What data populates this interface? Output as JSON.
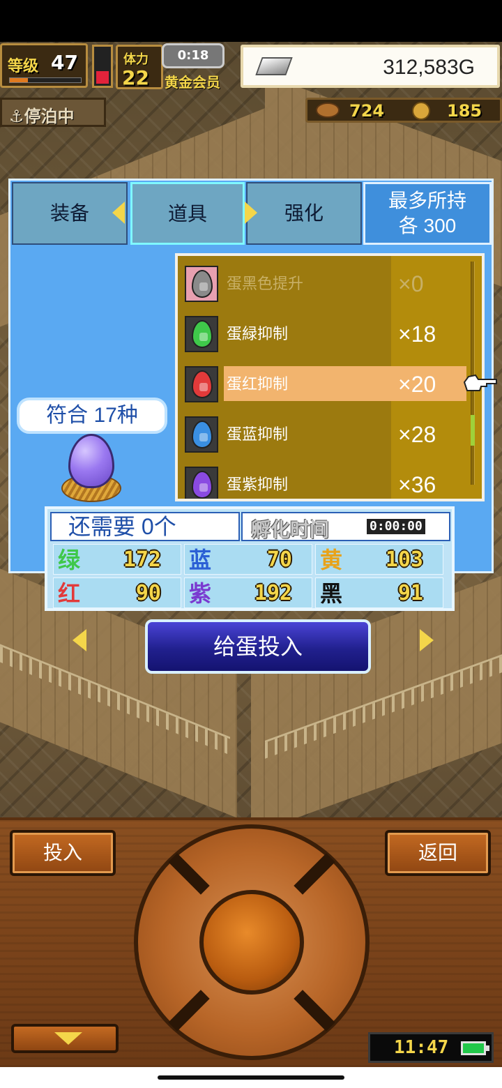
{
  "hud": {
    "level_label": "等级",
    "level": "47",
    "level_progress": 0.25,
    "stamina_level": 0.35,
    "body_label": "体力",
    "body_value": "22",
    "timer": "0:18",
    "member_label": "黄金会员",
    "gold": "312,583G",
    "anchor_label": "⚓停泊中",
    "resource_1": "724",
    "resource_2": "185"
  },
  "tabs": {
    "equip": "装备",
    "items": "道具",
    "enhance": "强化",
    "max_line1": "最多所持",
    "max_line2": "各 300"
  },
  "items": [
    {
      "name": "蛋黑色提升",
      "qty": "×0",
      "egg_color": "#8a8a8a",
      "state": "disabled"
    },
    {
      "name": "蛋緑抑制",
      "qty": "×18",
      "egg_color": "#3fc84a",
      "state": "normal"
    },
    {
      "name": "蛋红抑制",
      "qty": "×20",
      "egg_color": "#e23a3a",
      "state": "selected"
    },
    {
      "name": "蛋蓝抑制",
      "qty": "×28",
      "egg_color": "#3a8fe2",
      "state": "normal"
    },
    {
      "name": "蛋紫抑制",
      "qty": "×36",
      "egg_color": "#8a4ae2",
      "state": "normal"
    }
  ],
  "egg": {
    "species_label": "符合 17种"
  },
  "stats": {
    "need": "还需要 0个",
    "hatch_label": "孵化时间",
    "hatch_time": "0:00:00",
    "cells": [
      {
        "key": "绿",
        "value": "172",
        "color": "#3fc84a"
      },
      {
        "key": "蓝",
        "value": "70",
        "color": "#2b5fd5"
      },
      {
        "key": "黄",
        "value": "103",
        "color": "#e8a21a"
      },
      {
        "key": "红",
        "value": "90",
        "color": "#e23a3a"
      },
      {
        "key": "紫",
        "value": "192",
        "color": "#7a3ad0"
      },
      {
        "key": "黑",
        "value": "91",
        "color": "#111111"
      }
    ]
  },
  "feed_button": "给蛋投入",
  "controller": {
    "insert": "投入",
    "back": "返回",
    "clock": "11:47"
  }
}
